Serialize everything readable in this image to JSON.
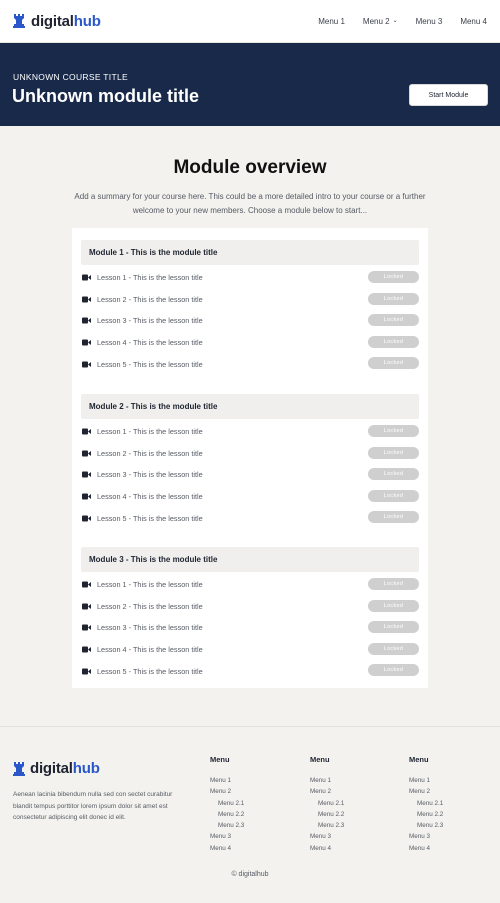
{
  "header": {
    "brand": {
      "prefix": "digital",
      "highlight": "hub"
    },
    "nav": [
      "Menu 1",
      "Menu 2",
      "Menu 3",
      "Menu 4"
    ]
  },
  "hero": {
    "course_title": "UNKNOWN COURSE TITLE",
    "module_title": "Unknown module title",
    "start_button": "Start Module"
  },
  "overview": {
    "title": "Module overview",
    "text": "Add a summary for your course here. This could be a more detailed intro to your course or a further welcome to your new members. Choose a module below to start..."
  },
  "modules": [
    {
      "title": "Module 1 - This is the module title",
      "lessons": [
        {
          "title": "Lesson 1 - This is the lesson title",
          "status": "Locked"
        },
        {
          "title": "Lesson 2 - This is the lesson title",
          "status": "Locked"
        },
        {
          "title": "Lesson 3 - This is the lesson title",
          "status": "Locked"
        },
        {
          "title": "Lesson 4 - This is the lesson title",
          "status": "Locked"
        },
        {
          "title": "Lesson 5 - This is the lesson title",
          "status": "Locked"
        }
      ]
    },
    {
      "title": "Module 2 - This is the module title",
      "lessons": [
        {
          "title": "Lesson 1 - This is the lesson title",
          "status": "Locked"
        },
        {
          "title": "Lesson 2 - This is the lesson title",
          "status": "Locked"
        },
        {
          "title": "Lesson 3 - This is the lesson title",
          "status": "Locked"
        },
        {
          "title": "Lesson 4 - This is the lesson title",
          "status": "Locked"
        },
        {
          "title": "Lesson 5 - This is the lesson title",
          "status": "Locked"
        }
      ]
    },
    {
      "title": "Module 3 - This is the module title",
      "lessons": [
        {
          "title": "Lesson 1 - This is the lesson title",
          "status": "Locked"
        },
        {
          "title": "Lesson 2 - This is the lesson title",
          "status": "Locked"
        },
        {
          "title": "Lesson 3 - This is the lesson title",
          "status": "Locked"
        },
        {
          "title": "Lesson 4 - This is the lesson title",
          "status": "Locked"
        },
        {
          "title": "Lesson 5 - This is the lesson title",
          "status": "Locked"
        }
      ]
    }
  ],
  "footer": {
    "brand": {
      "prefix": "digital",
      "highlight": "hub"
    },
    "description": "Aenean lacinia bibendum nulla sed con sectet curabitur blandit tempus porttitor lorem ipsum dolor sit amet est consectetur adipiscing elit donec id elit.",
    "columns": [
      {
        "heading": "Menu",
        "items": [
          {
            "label": "Menu 1",
            "sub": false
          },
          {
            "label": "Menu 2",
            "sub": false
          },
          {
            "label": "Menu 2.1",
            "sub": true
          },
          {
            "label": "Menu 2.2",
            "sub": true
          },
          {
            "label": "Menu 2.3",
            "sub": true
          },
          {
            "label": "Menu 3",
            "sub": false
          },
          {
            "label": "Menu 4",
            "sub": false
          }
        ]
      },
      {
        "heading": "Menu",
        "items": [
          {
            "label": "Menu 1",
            "sub": false
          },
          {
            "label": "Menu 2",
            "sub": false
          },
          {
            "label": "Menu 2.1",
            "sub": true
          },
          {
            "label": "Menu 2.2",
            "sub": true
          },
          {
            "label": "Menu 2.3",
            "sub": true
          },
          {
            "label": "Menu 3",
            "sub": false
          },
          {
            "label": "Menu 4",
            "sub": false
          }
        ]
      },
      {
        "heading": "Menu",
        "items": [
          {
            "label": "Menu 1",
            "sub": false
          },
          {
            "label": "Menu 2",
            "sub": false
          },
          {
            "label": "Menu 2.1",
            "sub": true
          },
          {
            "label": "Menu 2.2",
            "sub": true
          },
          {
            "label": "Menu 2.3",
            "sub": true
          },
          {
            "label": "Menu 3",
            "sub": false
          },
          {
            "label": "Menu 4",
            "sub": false
          }
        ]
      }
    ],
    "copyright": "© digitalhub"
  },
  "colors": {
    "brand_highlight": "#2a57c9",
    "hero_bg": "#18294a",
    "page_bg": "#f3f2ef",
    "locked_pill": "#cfcfcf"
  },
  "icons": {
    "brand": "chess-rook-icon",
    "lesson": "video-camera-icon",
    "dropdown": "chevron-down-icon"
  }
}
